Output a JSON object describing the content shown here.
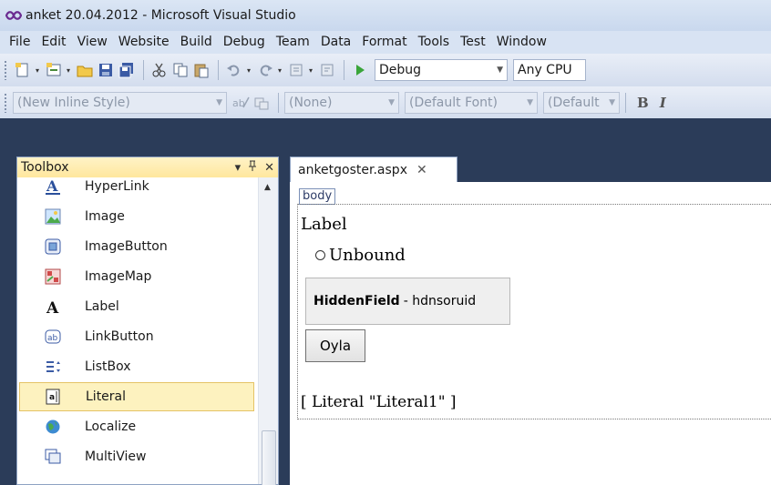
{
  "window": {
    "title": "anket 20.04.2012 - Microsoft Visual Studio"
  },
  "menubar": {
    "items": [
      "File",
      "Edit",
      "View",
      "Website",
      "Build",
      "Debug",
      "Team",
      "Data",
      "Format",
      "Tools",
      "Test",
      "Window"
    ]
  },
  "toolbar1": {
    "config_value": "Debug",
    "platform_value": "Any CPU"
  },
  "toolbar2": {
    "style_value": "(New Inline Style)",
    "block_value": "(None)",
    "font_value": "(Default Font)",
    "size_value": "(Default",
    "bold_label": "B",
    "italic_label": "I"
  },
  "toolbox": {
    "title": "Toolbox",
    "pin_glyph": "↓ ⍑",
    "items": [
      {
        "label": "HyperLink",
        "icon": "hyperlink-icon"
      },
      {
        "label": "Image",
        "icon": "image-icon"
      },
      {
        "label": "ImageButton",
        "icon": "imagebutton-icon"
      },
      {
        "label": "ImageMap",
        "icon": "imagemap-icon"
      },
      {
        "label": "Label",
        "icon": "label-icon"
      },
      {
        "label": "LinkButton",
        "icon": "linkbutton-icon"
      },
      {
        "label": "ListBox",
        "icon": "listbox-icon"
      },
      {
        "label": "Literal",
        "icon": "literal-icon",
        "selected": true
      },
      {
        "label": "Localize",
        "icon": "localize-icon"
      },
      {
        "label": "MultiView",
        "icon": "multiview-icon"
      }
    ]
  },
  "document": {
    "tab_label": "anketgoster.aspx",
    "body_tag": "body",
    "label_text": "Label",
    "radio_text": "Unbound",
    "hidden_field_bold": "HiddenField",
    "hidden_field_rest": "- hdnsoruid",
    "button_label": "Oyla",
    "literal_text": "[ Literal \"Literal1\" ]"
  },
  "colors": {
    "toolbox_header": "#ffe79d",
    "selected_item": "#fdf2bf",
    "chrome_background": "#2b3c59"
  }
}
